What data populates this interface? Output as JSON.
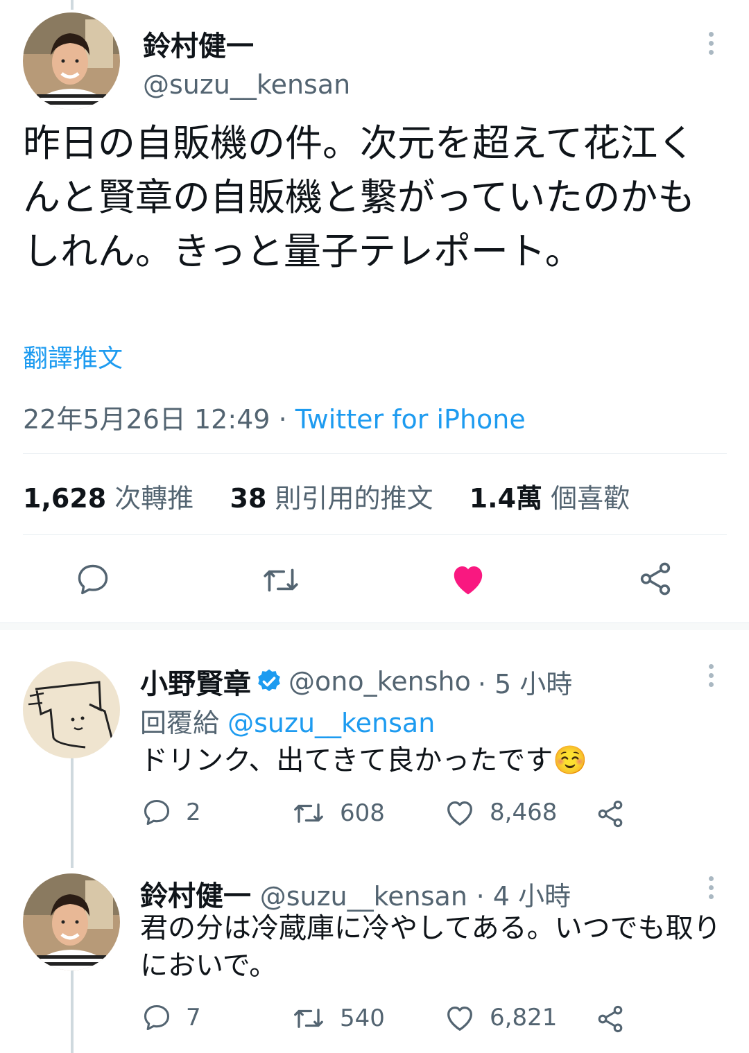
{
  "main_tweet": {
    "display_name": "鈴村健一",
    "handle": "@suzu__kensan",
    "text": "昨日の自販機の件。次元を超えて花江くんと賢章の自販機と繋がっていたのかもしれん。きっと量子テレポート。",
    "translate_label": "翻譯推文",
    "timestamp": "22年5月26日 12:49",
    "separator": " · ",
    "source": "Twitter for iPhone",
    "stats": {
      "retweets_count": "1,628",
      "retweets_label": "次轉推",
      "quotes_count": "38",
      "quotes_label": "則引用的推文",
      "likes_count": "1.4萬",
      "likes_label": "個喜歡"
    },
    "liked": true,
    "heart_color": "#f91880"
  },
  "replies": [
    {
      "display_name": "小野賢章",
      "verified": true,
      "handle": "@ono_kensho",
      "time": "· 5 小時",
      "reply_to_label": "回覆給",
      "reply_to_handle": "@suzu__kensan",
      "text": "ドリンク、出てきて良かったです",
      "emoji": "☺️",
      "reply_count": "2",
      "retweet_count": "608",
      "like_count": "8,468"
    },
    {
      "display_name": "鈴村健一",
      "handle": "@suzu__kensan",
      "time": "· 4 小時",
      "text": "君の分は冷蔵庫に冷やしてある。いつでも取りにおいで。",
      "reply_count": "7",
      "retweet_count": "540",
      "like_count": "6,821"
    }
  ],
  "colors": {
    "link_blue": "#1d9bf0",
    "secondary_gray": "#536471",
    "verified_blue": "#1d9bf0"
  }
}
